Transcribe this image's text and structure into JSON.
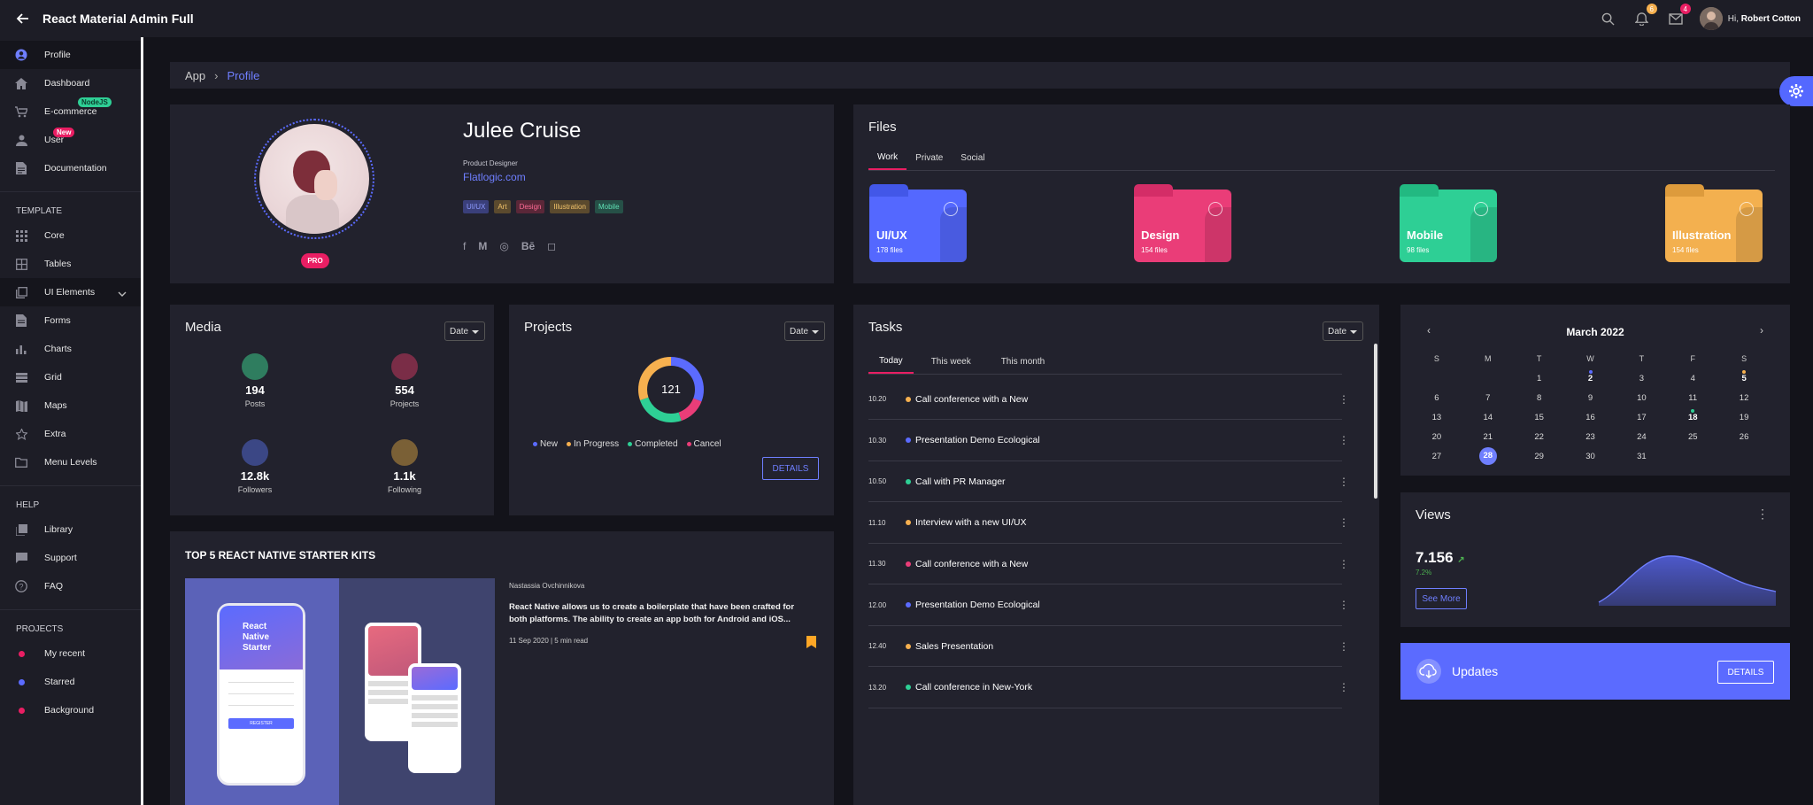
{
  "app": {
    "title": "React Material Admin Full"
  },
  "topbar": {
    "notifications_count": "6",
    "messages_count": "4",
    "greeting_prefix": "Hi, ",
    "user_name": "Robert Cotton"
  },
  "sidebar": {
    "items": [
      {
        "label": "Profile",
        "icon": "person-icon"
      },
      {
        "label": "Dashboard",
        "icon": "home-icon"
      },
      {
        "label": "E-commerce",
        "icon": "cart-icon",
        "badge": "NodeJS"
      },
      {
        "label": "User",
        "icon": "user-icon",
        "badge": "New"
      },
      {
        "label": "Documentation",
        "icon": "document-icon"
      }
    ],
    "template_title": "TEMPLATE",
    "template_items": [
      {
        "label": "Core"
      },
      {
        "label": "Tables"
      },
      {
        "label": "UI Elements"
      },
      {
        "label": "Forms"
      },
      {
        "label": "Charts"
      },
      {
        "label": "Grid"
      },
      {
        "label": "Maps"
      },
      {
        "label": "Extra"
      },
      {
        "label": "Menu Levels"
      }
    ],
    "help_title": "HELP",
    "help_items": [
      {
        "label": "Library"
      },
      {
        "label": "Support"
      },
      {
        "label": "FAQ"
      }
    ],
    "projects_title": "PROJECTS",
    "project_items": [
      {
        "label": "My recent",
        "color": "#e91e63"
      },
      {
        "label": "Starred",
        "color": "#5b6bff"
      },
      {
        "label": "Background",
        "color": "#e91e63"
      }
    ]
  },
  "breadcrumb": {
    "root": "App",
    "current": "Profile"
  },
  "profile": {
    "name": "Julee Cruise",
    "role": "Product Designer",
    "link": "Flatlogic.com",
    "badge": "PRO",
    "tags": [
      {
        "label": "UI/UX",
        "bg": "#3a3f7a",
        "fg": "#8f9bff"
      },
      {
        "label": "Art",
        "bg": "#5b4a2e",
        "fg": "#f2c36b"
      },
      {
        "label": "Design",
        "bg": "#5a2738",
        "fg": "#ff6b95"
      },
      {
        "label": "Illustration",
        "bg": "#5b4a2e",
        "fg": "#f2c36b"
      },
      {
        "label": "Mobile",
        "bg": "#265047",
        "fg": "#5fe0b5"
      }
    ],
    "socials": [
      "f",
      "M",
      "◎",
      "Bē",
      "◻"
    ]
  },
  "files": {
    "title": "Files",
    "tabs": [
      "Work",
      "Private",
      "Social"
    ],
    "folders": [
      {
        "name": "UI/UX",
        "count": "178 files",
        "color": "#5468ff"
      },
      {
        "name": "Design",
        "count": "154 files",
        "color": "#ea3d78"
      },
      {
        "name": "Mobile",
        "count": "98 files",
        "color": "#2ecf95"
      },
      {
        "name": "Illustration",
        "count": "154 files",
        "color": "#f3b04f"
      }
    ]
  },
  "media": {
    "title": "Media",
    "date_label": "Date",
    "stats": [
      {
        "value": "194",
        "label": "Posts",
        "color": "#2f7d5f"
      },
      {
        "value": "554",
        "label": "Projects",
        "color": "#7a2d47"
      },
      {
        "value": "12.8k",
        "label": "Followers",
        "color": "#3b4785"
      },
      {
        "value": "1.1k",
        "label": "Following",
        "color": "#7a6036"
      }
    ]
  },
  "projects": {
    "title": "Projects",
    "date_label": "Date",
    "total": "121",
    "legend": [
      {
        "label": "New",
        "color": "#5b6bff"
      },
      {
        "label": "In Progress",
        "color": "#f6b04f"
      },
      {
        "label": "Completed",
        "color": "#2ecf95"
      },
      {
        "label": "Cancel",
        "color": "#ea3d78"
      }
    ],
    "details_label": "DETAILS"
  },
  "tasks": {
    "title": "Tasks",
    "date_label": "Date",
    "tabs": [
      "Today",
      "This week",
      "This month"
    ],
    "items": [
      {
        "time": "10.20",
        "title": "Call conference with a New",
        "color": "#f6b04f"
      },
      {
        "time": "10.30",
        "title": "Presentation Demo Ecological",
        "color": "#5b6bff"
      },
      {
        "time": "10.50",
        "title": "Call with PR Manager",
        "color": "#2ecf95"
      },
      {
        "time": "11.10",
        "title": "Interview with a new UI/UX",
        "color": "#f6b04f"
      },
      {
        "time": "11.30",
        "title": "Call conference with a New",
        "color": "#ea3d78"
      },
      {
        "time": "12.00",
        "title": "Presentation Demo Ecological",
        "color": "#5b6bff"
      },
      {
        "time": "12.40",
        "title": "Sales Presentation",
        "color": "#f6b04f"
      },
      {
        "time": "13.20",
        "title": "Call conference in New-York",
        "color": "#2ecf95"
      }
    ]
  },
  "calendar": {
    "month": "March 2022",
    "weekdays": [
      "S",
      "M",
      "T",
      "W",
      "T",
      "F",
      "S"
    ],
    "weeks": [
      [
        "",
        "",
        "1",
        "2",
        "3",
        "4",
        "5"
      ],
      [
        "6",
        "7",
        "8",
        "9",
        "10",
        "11",
        "12"
      ],
      [
        "13",
        "14",
        "15",
        "16",
        "17",
        "18",
        "19"
      ],
      [
        "20",
        "21",
        "22",
        "23",
        "24",
        "25",
        "26"
      ],
      [
        "27",
        "28",
        "29",
        "30",
        "31",
        "",
        ""
      ]
    ],
    "today": "28",
    "events": [
      {
        "day": "2",
        "color": "#5b6bff"
      },
      {
        "day": "5",
        "color": "#f6b04f"
      },
      {
        "day": "18",
        "color": "#2ecf95"
      }
    ]
  },
  "views": {
    "title": "Views",
    "value": "7.156",
    "change": "7.2%",
    "see_more": "See More"
  },
  "updates": {
    "title": "Updates",
    "details_label": "DETAILS"
  },
  "article": {
    "section_title": "TOP 5 REACT NATIVE STARTER KITS",
    "author": "Nastassia Ovchinnikova",
    "excerpt": "React Native allows us to create a boilerplate that have been crafted for both platforms. The ability to create an app both for Android and iOS...",
    "meta": "11 Sep 2020 | 5 min read",
    "phone_title_1": "React",
    "phone_title_2": "Native",
    "phone_title_3": "Starter",
    "register_label": "REGISTER"
  },
  "colors": {
    "accent": "#5b6bff",
    "pink": "#e91e63",
    "panel": "#22222d",
    "bg": "#13131a"
  }
}
